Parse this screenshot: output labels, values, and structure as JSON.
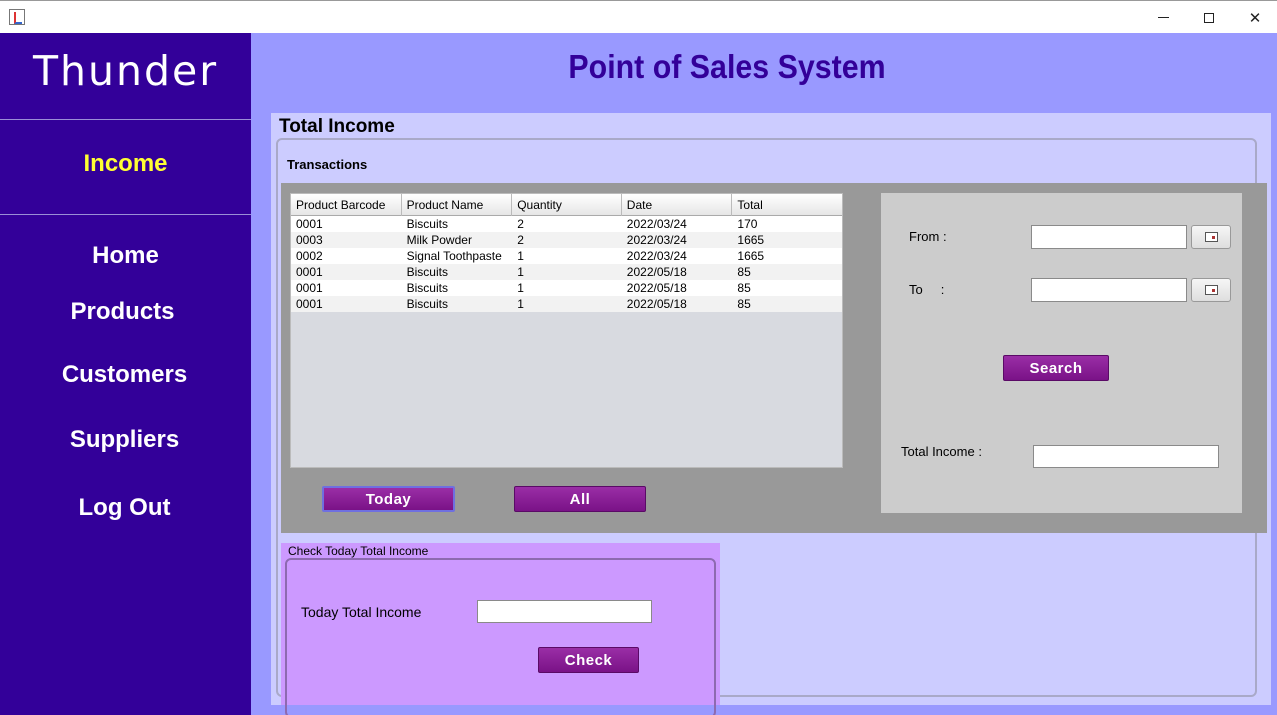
{
  "window": {
    "minimize_glyph": "",
    "close_glyph": "✕"
  },
  "sidebar": {
    "brand": "Thunder",
    "active_item": "Income",
    "items": [
      "Home",
      "Products",
      "Customers",
      "Suppliers",
      "Log Out"
    ],
    "bg_color": "#330099",
    "active_color": "#ffff33"
  },
  "header": {
    "title": "Point of Sales System"
  },
  "income_panel": {
    "title": "Total Income",
    "transactions_label": "Transactions",
    "table": {
      "columns": [
        "Product Barcode",
        "Product Name",
        "Quantity",
        "Date",
        "Total"
      ],
      "rows": [
        [
          "0001",
          "Biscuits",
          "2",
          "2022/03/24",
          "170"
        ],
        [
          "0003",
          "Milk Powder",
          "2",
          "2022/03/24",
          "1665"
        ],
        [
          "0002",
          "Signal Toothpaste",
          "1",
          "2022/03/24",
          "1665"
        ],
        [
          "0001",
          "Biscuits",
          "1",
          "2022/05/18",
          "85"
        ],
        [
          "0001",
          "Biscuits",
          "1",
          "2022/05/18",
          "85"
        ],
        [
          "0001",
          "Biscuits",
          "1",
          "2022/05/18",
          "85"
        ]
      ]
    },
    "today_button": "Today",
    "all_button": "All",
    "search": {
      "from_label": "From :",
      "to_label": "To     :",
      "from_value": "",
      "to_value": "",
      "search_button": "Search",
      "total_label": "Total Income :",
      "total_value": ""
    }
  },
  "today_panel": {
    "title": "Check Today Total Income",
    "label": "Today Total Income",
    "value": "",
    "check_button": "Check"
  },
  "colors": {
    "main_bg": "#9999ff",
    "panel_bg": "#ccccff",
    "button_purple": "#8b1a99",
    "today_panel_bg": "#cc99ff"
  }
}
